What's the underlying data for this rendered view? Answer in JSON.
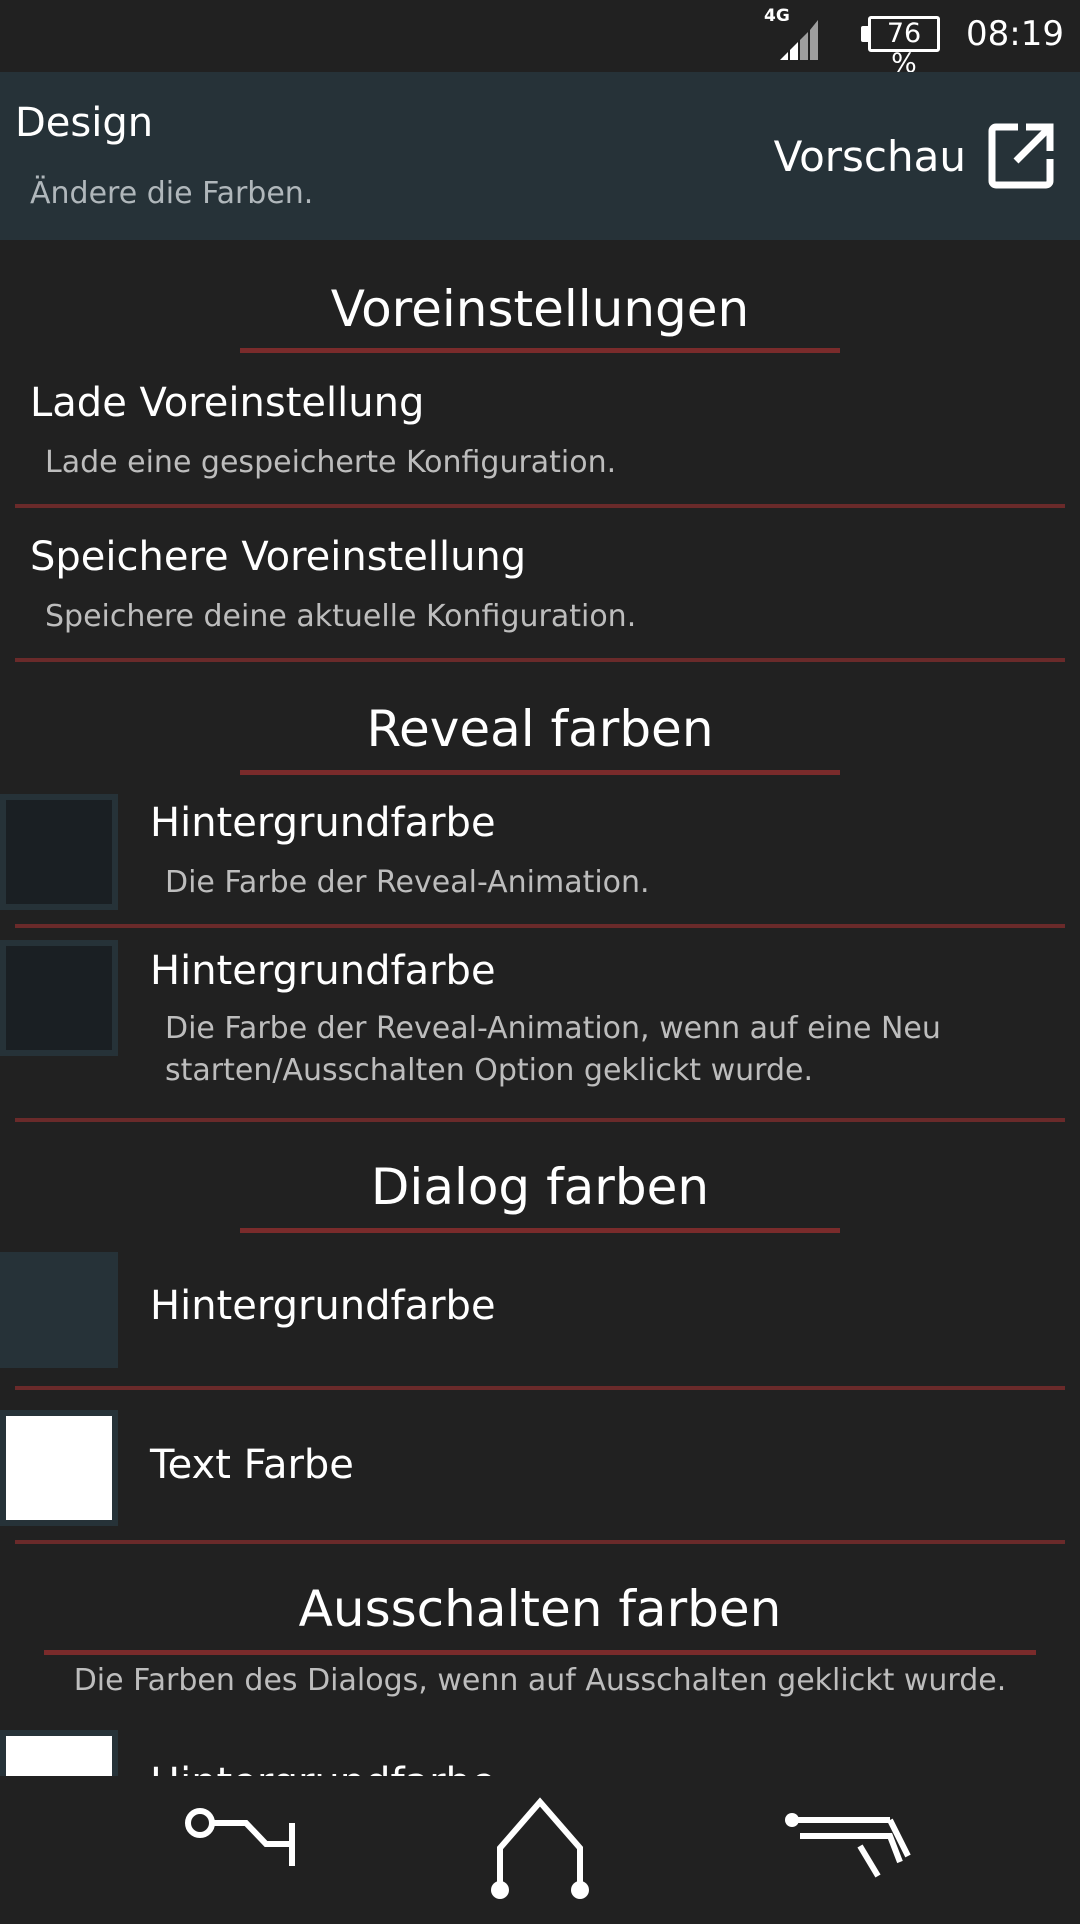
{
  "status": {
    "network": "4G",
    "battery": "76 %",
    "time": "08:19"
  },
  "appbar": {
    "title": "Design",
    "subtitle": "Ändere die Farben.",
    "preview_label": "Vorschau",
    "preview_icon": "open-in-new-icon"
  },
  "sections": {
    "presets": {
      "title": "Voreinstellungen",
      "load_title": "Lade Voreinstellung",
      "load_desc": "Lade eine gespeicherte Konfiguration.",
      "save_title": "Speichere Voreinstellung",
      "save_desc": "Speichere deine aktuelle Konfiguration."
    },
    "reveal": {
      "title": "Reveal farben",
      "bg1_title": "Hintergrundfarbe",
      "bg1_desc": "Die Farbe der Reveal-Animation.",
      "bg1_color": "#1a1f23",
      "bg2_title": "Hintergrundfarbe",
      "bg2_desc": "Die Farbe der Reveal-Animation, wenn auf eine Neu starten/Ausschalten Option geklickt wurde.",
      "bg2_color": "#1a1f23"
    },
    "dialog": {
      "title": "Dialog farben",
      "bg_title": "Hintergrundfarbe",
      "bg_color": "#263238",
      "text_title": "Text Farbe",
      "text_color": "#ffffff"
    },
    "poweroff": {
      "title": "Ausschalten farben",
      "desc": "Die Farben des Dialogs, wenn auf Ausschalten geklickt wurde.",
      "bg_title": "Hintergrundfarbe",
      "bg_color": "#ffffff"
    }
  },
  "colors": {
    "accent_line": "#7a2b2b",
    "appbar": "#263238",
    "background": "#212121"
  },
  "navbar": {
    "icons": [
      "back-icon",
      "home-icon",
      "recents-icon"
    ]
  }
}
